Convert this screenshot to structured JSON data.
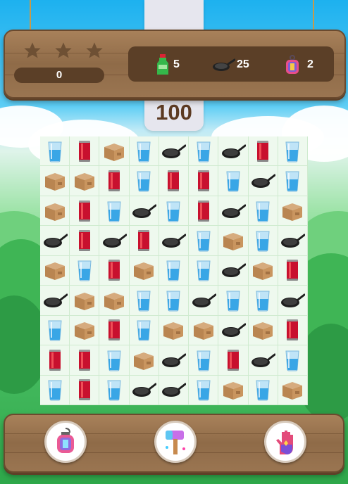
{
  "level": {
    "stars_total": 3,
    "stars_earned": 0,
    "score": "0",
    "moves_left": "100"
  },
  "goals": [
    {
      "item": "soda-bottle",
      "count": "5"
    },
    {
      "item": "frying-pan",
      "count": "25"
    },
    {
      "item": "lantern",
      "count": "2"
    }
  ],
  "board": {
    "rows": 9,
    "cols": 9,
    "tiles": [
      [
        "glass",
        "can",
        "box",
        "glass",
        "pan",
        "glass",
        "pan",
        "can",
        "glass"
      ],
      [
        "box",
        "box",
        "can",
        "glass",
        "can",
        "can",
        "glass",
        "pan",
        "glass"
      ],
      [
        "box",
        "can",
        "glass",
        "pan",
        "glass",
        "can",
        "pan",
        "glass",
        "box"
      ],
      [
        "pan",
        "can",
        "pan",
        "can",
        "pan",
        "glass",
        "box",
        "glass",
        "pan"
      ],
      [
        "box",
        "glass",
        "can",
        "box",
        "glass",
        "glass",
        "pan",
        "box",
        "can"
      ],
      [
        "pan",
        "box",
        "box",
        "glass",
        "glass",
        "pan",
        "glass",
        "glass",
        "pan"
      ],
      [
        "glass",
        "box",
        "can",
        "glass",
        "box",
        "box",
        "pan",
        "box",
        "can"
      ],
      [
        "can",
        "can",
        "glass",
        "box",
        "pan",
        "glass",
        "can",
        "pan",
        "glass"
      ],
      [
        "glass",
        "can",
        "glass",
        "pan",
        "pan",
        "glass",
        "box",
        "glass",
        "box"
      ]
    ]
  },
  "boosters": [
    {
      "name": "lantern-bomb"
    },
    {
      "name": "hammer"
    },
    {
      "name": "magic-hand"
    }
  ],
  "colors": {
    "wood": "#9a7551",
    "wood_dark": "#5b3f27",
    "moves_text": "#5b3a22",
    "board_bg": "#eef9ee"
  }
}
